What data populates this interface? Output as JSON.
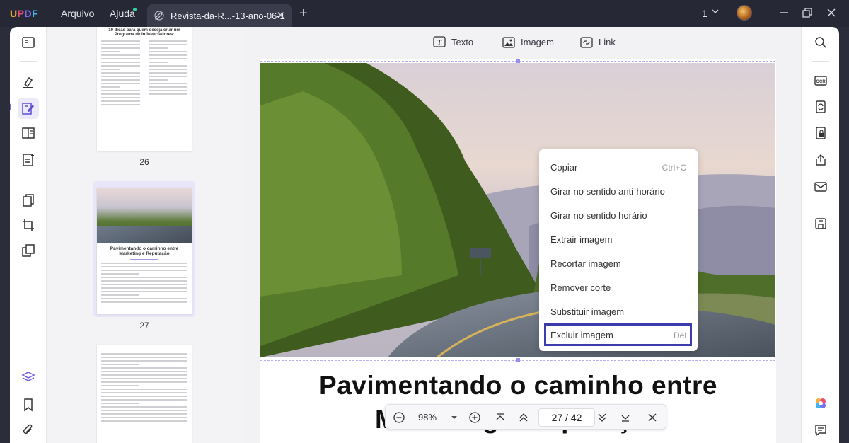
{
  "app": {
    "logo": "UPDF",
    "menus": [
      "Arquivo",
      "Ajuda"
    ],
    "tab_title": "Revista-da-R...-13-ano-06-1",
    "page_selector": "1"
  },
  "edit_toolbar": {
    "text_label": "Texto",
    "image_label": "Imagem",
    "link_label": "Link"
  },
  "thumbnails": [
    {
      "page": "26",
      "title": "10 dicas para quem deseja criar um Programa de Influenciadores:"
    },
    {
      "page": "27",
      "title": "Pavimentando o caminho entre Marketing e Reputação"
    },
    {
      "page": "",
      "title": ""
    }
  ],
  "document": {
    "headline": "Pavimentando o caminho entre",
    "headline_partial": "Marketing e Reputação"
  },
  "context_menu": {
    "items": [
      {
        "label": "Copiar",
        "shortcut": "Ctrl+C"
      },
      {
        "label": "Girar no sentido anti-horário",
        "shortcut": ""
      },
      {
        "label": "Girar no sentido horário",
        "shortcut": ""
      },
      {
        "label": "Extrair imagem",
        "shortcut": ""
      },
      {
        "label": "Recortar imagem",
        "shortcut": ""
      },
      {
        "label": "Remover corte",
        "shortcut": ""
      },
      {
        "label": "Substituir imagem",
        "shortcut": ""
      },
      {
        "label": "Excluir imagem",
        "shortcut": "Del"
      }
    ],
    "highlighted": "Excluir imagem"
  },
  "zoom_bar": {
    "zoom": "98%",
    "current_page": "27",
    "separator": "/",
    "total_pages": "42"
  },
  "colors": {
    "accent": "#7869e6",
    "highlight_border": "#3d3cae",
    "titlebar": "#262836"
  }
}
